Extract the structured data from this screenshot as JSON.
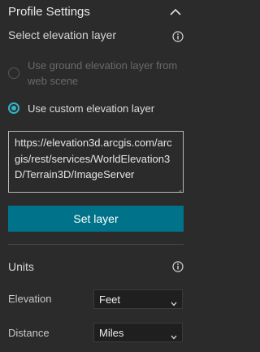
{
  "header": {
    "title": "Profile Settings",
    "collapse_icon": "chevron-up-icon"
  },
  "elevation": {
    "label": "Select elevation layer",
    "info_icon": "info-icon",
    "options": [
      {
        "label": "Use ground elevation layer from web scene",
        "checked": false,
        "disabled": true
      },
      {
        "label": "Use custom elevation layer",
        "checked": true,
        "disabled": false
      }
    ],
    "url": "https://elevation3d.arcgis.com/arcgis/rest/services/WorldElevation3D/Terrain3D/ImageServer",
    "set_layer_label": "Set layer"
  },
  "units": {
    "label": "Units",
    "info_icon": "info-icon",
    "elevation_label": "Elevation",
    "elevation_value": "Feet",
    "distance_label": "Distance",
    "distance_value": "Miles"
  },
  "colors": {
    "accent": "#35b3c7",
    "button": "#00738a",
    "background": "#2b2b2b"
  }
}
